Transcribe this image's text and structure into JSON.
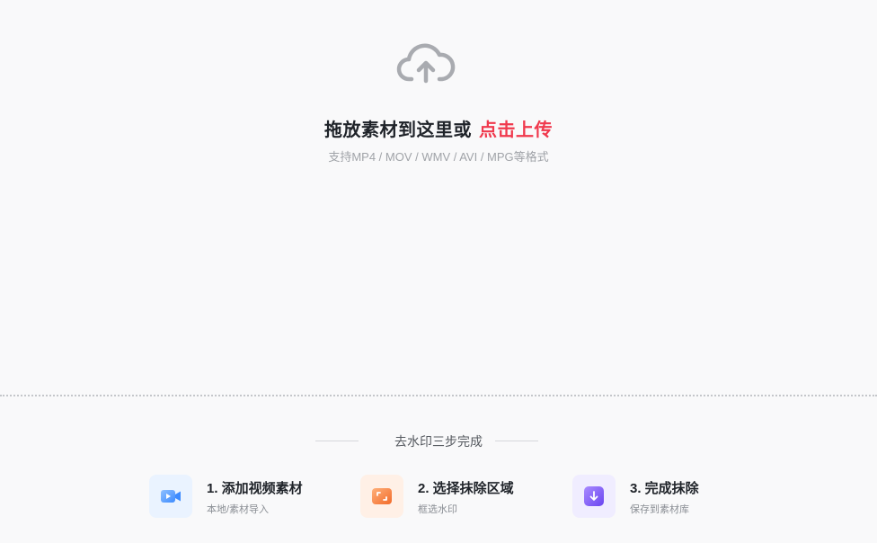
{
  "upload": {
    "icon": "cloud-upload-icon",
    "prompt_text": "拖放素材到这里或",
    "click_link": "点击上传",
    "formats_text": "支持MP4 / MOV / WMV / AVI / MPG等格式",
    "link_color": "#f0394d"
  },
  "steps_section": {
    "title": "去水印三步完成",
    "steps": [
      {
        "title": "1. 添加视频素材",
        "desc": "本地/素材导入",
        "icon": "video-icon",
        "color": "#3d8bff"
      },
      {
        "title": "2. 选择抹除区域",
        "desc": "框选水印",
        "icon": "crop-frame-icon",
        "color": "#f57a3d"
      },
      {
        "title": "3. 完成抹除",
        "desc": "保存到素材库",
        "icon": "download-icon",
        "color": "#7c5cf5"
      }
    ]
  }
}
